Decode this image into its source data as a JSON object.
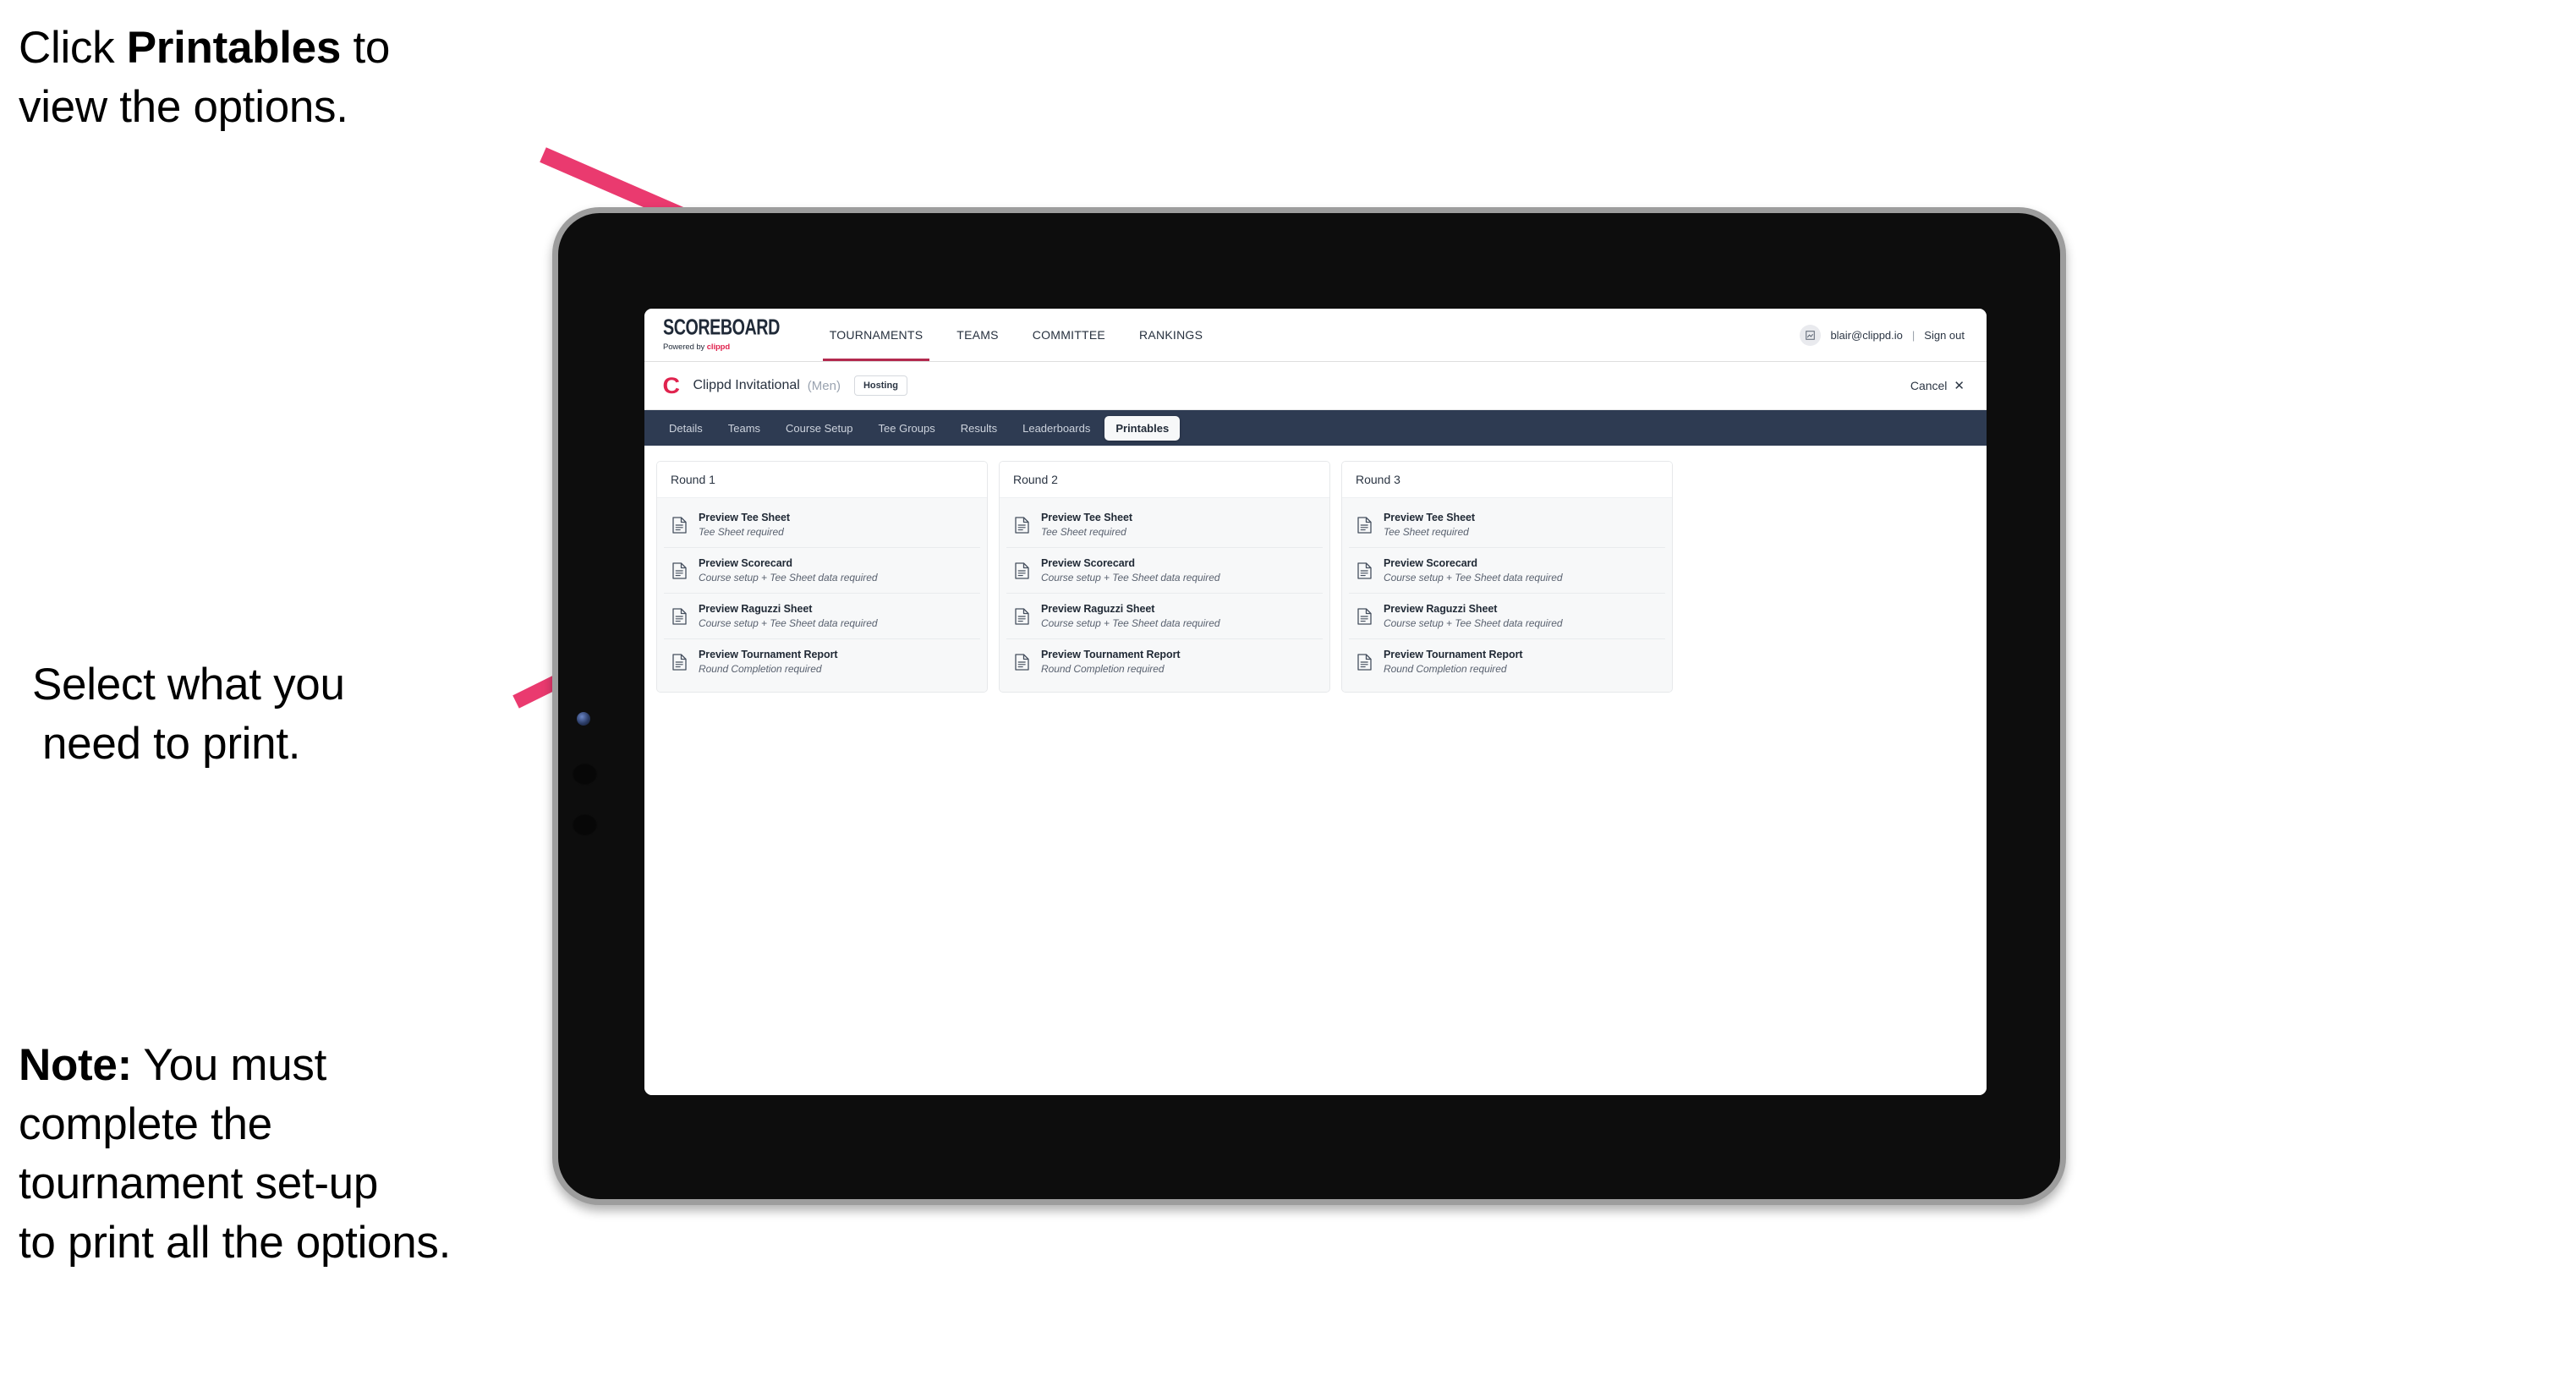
{
  "annotations": {
    "top": {
      "line1_pre": "Click ",
      "line1_strong": "Printables",
      "line1_post": " to",
      "line2": "view the options."
    },
    "middle": {
      "line1": "Select what you",
      "line2": "need to print."
    },
    "note": {
      "label": "Note:",
      "line1_rest": " You must",
      "line2": "complete the",
      "line3": "tournament set-up",
      "line4": "to print all the options."
    },
    "arrow_color": "#ea3a6f"
  },
  "app": {
    "topnav": {
      "brand_main": "SCOREBOARD",
      "brand_sub_prefix": "Powered by ",
      "brand_sub_word": "clippd",
      "items": [
        {
          "label": "TOURNAMENTS",
          "active": true
        },
        {
          "label": "TEAMS",
          "active": false
        },
        {
          "label": "COMMITTEE",
          "active": false
        },
        {
          "label": "RANKINGS",
          "active": false
        }
      ],
      "avatar_glyph": "⛶",
      "user_email": "blair@clippd.io",
      "separator": "|",
      "sign_out": "Sign out"
    },
    "tournament_bar": {
      "logo_letter": "C",
      "name": "Clippd Invitational",
      "gender": "(Men)",
      "status_chip": "Hosting",
      "cancel_label": "Cancel",
      "cancel_icon": "✕"
    },
    "tabs": [
      {
        "label": "Details",
        "active": false
      },
      {
        "label": "Teams",
        "active": false
      },
      {
        "label": "Course Setup",
        "active": false
      },
      {
        "label": "Tee Groups",
        "active": false
      },
      {
        "label": "Results",
        "active": false
      },
      {
        "label": "Leaderboards",
        "active": false
      },
      {
        "label": "Printables",
        "active": true
      }
    ],
    "rounds": [
      {
        "title": "Round 1",
        "items": [
          {
            "title": "Preview Tee Sheet",
            "sub": "Tee Sheet required"
          },
          {
            "title": "Preview Scorecard",
            "sub": "Course setup + Tee Sheet data required"
          },
          {
            "title": "Preview Raguzzi Sheet",
            "sub": "Course setup + Tee Sheet data required"
          },
          {
            "title": "Preview Tournament Report",
            "sub": "Round Completion required"
          }
        ]
      },
      {
        "title": "Round 2",
        "items": [
          {
            "title": "Preview Tee Sheet",
            "sub": "Tee Sheet required"
          },
          {
            "title": "Preview Scorecard",
            "sub": "Course setup + Tee Sheet data required"
          },
          {
            "title": "Preview Raguzzi Sheet",
            "sub": "Course setup + Tee Sheet data required"
          },
          {
            "title": "Preview Tournament Report",
            "sub": "Round Completion required"
          }
        ]
      },
      {
        "title": "Round 3",
        "items": [
          {
            "title": "Preview Tee Sheet",
            "sub": "Tee Sheet required"
          },
          {
            "title": "Preview Scorecard",
            "sub": "Course setup + Tee Sheet data required"
          },
          {
            "title": "Preview Raguzzi Sheet",
            "sub": "Course setup + Tee Sheet data required"
          },
          {
            "title": "Preview Tournament Report",
            "sub": "Round Completion required"
          }
        ]
      }
    ],
    "colors": {
      "brand_pink": "#e0234e",
      "tabbar_dark": "#2e3b52",
      "accent_underline": "#b3294e"
    }
  }
}
